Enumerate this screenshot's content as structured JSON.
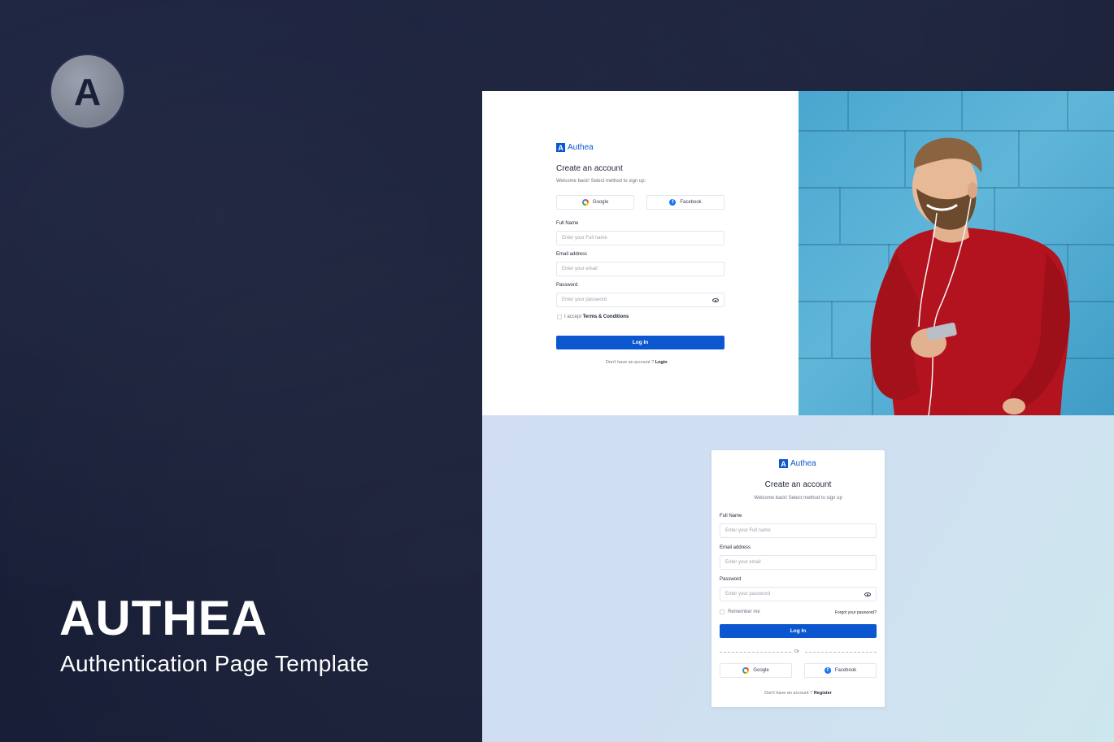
{
  "brand": {
    "logo_letter": "A",
    "title": "AUTHEA",
    "subtitle": "Authentication Page Template"
  },
  "colors": {
    "background": "#1a2039",
    "primary": "#0b57d0",
    "sweater": "#b3131e",
    "wall": "#4aa6cf"
  },
  "signup_split": {
    "brand_name": "Authea",
    "brand_mark": "A",
    "heading": "Create an account",
    "subheading": "Welcome back! Select method to sign up:",
    "google_label": "Google",
    "facebook_label": "Facebook",
    "full_name_label": "Full Name",
    "full_name_placeholder": "Enter your Full name",
    "email_label": "Email address",
    "email_placeholder": "Enter your email",
    "password_label": "Password",
    "password_placeholder": "Enter your password",
    "terms_prefix": "I accept",
    "terms_link": "Terms & Conditions",
    "submit_label": "Log In",
    "footer_prefix": "Don't have an account ?",
    "footer_link": "Login"
  },
  "signup_card": {
    "brand_name": "Authea",
    "brand_mark": "A",
    "heading": "Create an account",
    "subheading": "Welcome back! Select method to sign up",
    "full_name_label": "Full Name",
    "full_name_placeholder": "Enter your Full name",
    "email_label": "Email address",
    "email_placeholder": "Enter your email",
    "password_label": "Password",
    "password_placeholder": "Enter your password",
    "remember_label": "Remember me",
    "forgot_link": "Forgot your password?",
    "submit_label": "Log In",
    "divider_text": "Or",
    "google_label": "Google",
    "facebook_label": "Facebook",
    "footer_prefix": "Don't have an account ?",
    "footer_link": "Register"
  }
}
